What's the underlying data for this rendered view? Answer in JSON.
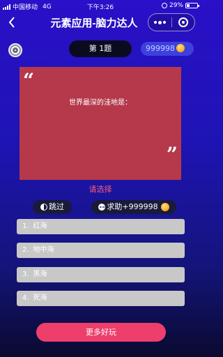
{
  "status_bar": {
    "carrier": "中国移动",
    "network": "4G",
    "time": "下午3:26",
    "battery_percent": "29%",
    "battery_level": 0.29
  },
  "nav": {
    "title": "元素应用-脑力达人"
  },
  "quiz": {
    "question_number": "第 1题",
    "coins": "999998",
    "question_text": "世界最深的洼地是：",
    "quote_open": "“",
    "quote_close": "”",
    "prompt": "请选择",
    "skip_label": "跳过",
    "help_label": "求助+999998",
    "options": [
      {
        "num": "1.",
        "text": "红海"
      },
      {
        "num": "2.",
        "text": "地中海"
      },
      {
        "num": "3.",
        "text": "黑海"
      },
      {
        "num": "4.",
        "text": "死海"
      }
    ],
    "more_fun_label": "更多好玩"
  },
  "colors": {
    "card": "#b5394a",
    "prompt": "#ff5a78",
    "more_fun": "#ee3e6b",
    "option_bg": "#c8c8c8"
  },
  "icons": [
    "signal-icon",
    "location-icon",
    "battery-icon",
    "back-icon",
    "more-icon",
    "close-capsule-icon",
    "music-icon",
    "coin-icon",
    "half-moon-icon",
    "chat-icon"
  ]
}
